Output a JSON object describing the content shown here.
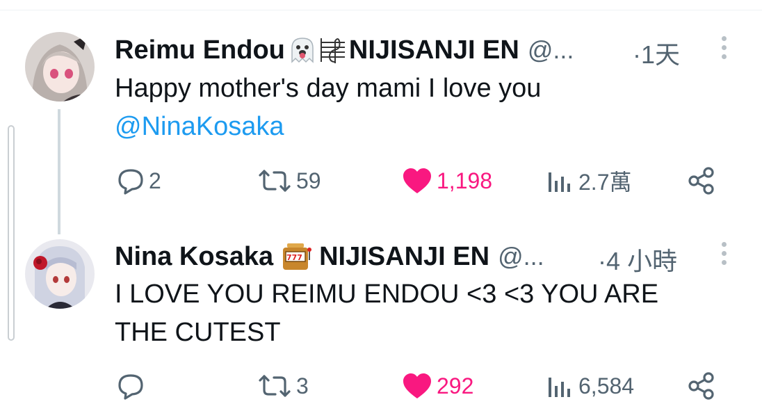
{
  "tweets": [
    {
      "name": "Reimu Endou",
      "emojis": [
        "ghost-tongue-emoji",
        "music-note-emoji"
      ],
      "org": "NIJISANJI EN",
      "handle": "@...",
      "time": "·1天",
      "text_line1": "Happy mother's day mami I love you",
      "mention": "@NinaKosaka",
      "replies": "2",
      "retweets": "59",
      "likes": "1,198",
      "views": "2.7萬"
    },
    {
      "name": "Nina Kosaka",
      "emojis": [
        "slot-machine-emoji"
      ],
      "org": "NIJISANJI EN",
      "handle": "@...",
      "time": "·4 小時",
      "text_line1": "I LOVE YOU REIMU ENDOU <3 <3 YOU ARE",
      "text_line2": "THE CUTEST",
      "replies": "",
      "retweets": "3",
      "likes": "292",
      "views": "6,584"
    }
  ],
  "colors": {
    "like": "#f91880",
    "mention": "#1d9bf0",
    "muted": "#536471",
    "text": "#0f1419"
  }
}
